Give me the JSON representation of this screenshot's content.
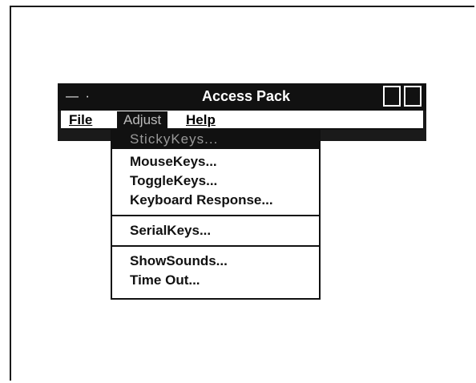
{
  "window": {
    "title": "Access Pack"
  },
  "menubar": {
    "items": [
      "File",
      "Adjust",
      "Help"
    ]
  },
  "dropdown": {
    "items": [
      "StickyKeys...",
      "MouseKeys...",
      "ToggleKeys...",
      "Keyboard Response...",
      "SerialKeys...",
      "ShowSounds...",
      "Time Out..."
    ]
  }
}
